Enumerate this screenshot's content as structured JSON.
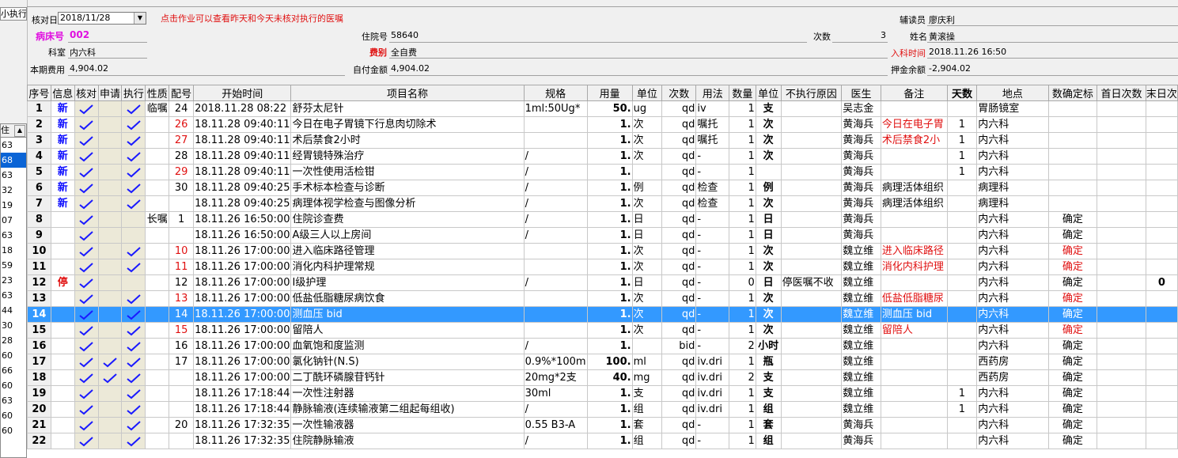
{
  "left": {
    "tab_label": "小执行",
    "list_header": "住",
    "items": [
      "63",
      "68",
      "63",
      "32",
      "19",
      "07",
      "63",
      "18",
      "59",
      "23",
      "63",
      "44",
      "30",
      "28",
      "60",
      "66",
      "60",
      "63",
      "60",
      "60"
    ],
    "selected_index": 1
  },
  "header": {
    "check_date_label": "核对日",
    "check_date_value": "2018/11/28",
    "hint": "点击作业可以查看昨天和今天未核对执行的医嘱",
    "reader_label": "辅读员",
    "reader_value": "廖庆利",
    "bed_label": "病床号",
    "bed_value": "002",
    "admission_label": "住院号",
    "admission_value": "58640",
    "times_label": "次数",
    "times_value": "3",
    "name_label": "姓名",
    "name_value": "黄滚操",
    "dept_label": "科室",
    "dept_value": "内六科",
    "fee_type_label": "费别",
    "fee_type_value": "全自费",
    "admit_time_label": "入科时间",
    "admit_time_value": "2018.11.26 16:50",
    "period_cost_label": "本期费用",
    "period_cost_value": "4,904.02",
    "self_pay_label": "自付金额",
    "self_pay_value": "4,904.02",
    "deposit_label": "押金余额",
    "deposit_value": "-2,904.02"
  },
  "grid": {
    "columns": [
      "序号",
      "信息",
      "核对",
      "申请",
      "执行",
      "性质",
      "配号",
      "开始时间",
      "项目名称",
      "规格",
      "用量",
      "单位",
      "次数",
      "用法",
      "数量",
      "单位",
      "不执行原因",
      "医生",
      "备注",
      "天数",
      "地点",
      "数确定标",
      "首日次数",
      "末日次"
    ],
    "rows": [
      {
        "seq": "1",
        "info": "新",
        "check": true,
        "apply": false,
        "exec": true,
        "nature": "临嘱",
        "group": "24",
        "group_red": false,
        "start": "2018.11.28 08:22",
        "item": "舒芬太尼针",
        "spec": "1ml:50Ug*",
        "dose": "50.",
        "unit": "ug",
        "freq": "qd",
        "usage": "iv",
        "qty": "1",
        "unit2": "支",
        "reason": "",
        "doctor": "吴志金",
        "note": "",
        "note_red": false,
        "days": "",
        "place": "胃肠镜室",
        "confirm": "",
        "confirm_red": false,
        "first": "",
        "last": ""
      },
      {
        "seq": "2",
        "info": "新",
        "check": true,
        "apply": false,
        "exec": true,
        "nature": "",
        "group": "26",
        "group_red": true,
        "start": "18.11.28 09:40:11",
        "item": "今日在电子胃镜下行息肉切除术",
        "spec": "",
        "dose": "1.",
        "unit": "次",
        "freq": "qd",
        "usage": "嘱托",
        "qty": "1",
        "unit2": "次",
        "reason": "",
        "doctor": "黄海兵",
        "note": "今日在电子胃",
        "note_red": true,
        "days": "1",
        "place": "内六科",
        "confirm": "",
        "confirm_red": false,
        "first": "",
        "last": ""
      },
      {
        "seq": "3",
        "info": "新",
        "check": true,
        "apply": false,
        "exec": true,
        "nature": "",
        "group": "27",
        "group_red": true,
        "start": "18.11.28 09:40:11",
        "item": "术后禁食2小时",
        "spec": "",
        "dose": "1.",
        "unit": "次",
        "freq": "qd",
        "usage": "嘱托",
        "qty": "1",
        "unit2": "次",
        "reason": "",
        "doctor": "黄海兵",
        "note": "术后禁食2小",
        "note_red": true,
        "days": "1",
        "place": "内六科",
        "confirm": "",
        "confirm_red": false,
        "first": "",
        "last": ""
      },
      {
        "seq": "4",
        "info": "新",
        "check": true,
        "apply": false,
        "exec": true,
        "nature": "",
        "group": "28",
        "group_red": false,
        "start": "18.11.28 09:40:11",
        "item": "经胃镜特殊治疗",
        "spec": "/",
        "dose": "1.",
        "unit": "次",
        "freq": "qd",
        "usage": "-",
        "qty": "1",
        "unit2": "次",
        "reason": "",
        "doctor": "黄海兵",
        "note": "",
        "note_red": false,
        "days": "1",
        "place": "内六科",
        "confirm": "",
        "confirm_red": false,
        "first": "",
        "last": ""
      },
      {
        "seq": "5",
        "info": "新",
        "check": true,
        "apply": false,
        "exec": true,
        "nature": "",
        "group": "29",
        "group_red": true,
        "start": "18.11.28 09:40:11",
        "item": "一次性使用活检钳",
        "spec": " /",
        "dose": "1.",
        "unit": "",
        "freq": "qd",
        "usage": "-",
        "qty": "1",
        "unit2": "",
        "reason": "",
        "doctor": "黄海兵",
        "note": "",
        "note_red": false,
        "days": "1",
        "place": "内六科",
        "confirm": "",
        "confirm_red": false,
        "first": "",
        "last": ""
      },
      {
        "seq": "6",
        "info": "新",
        "check": true,
        "apply": false,
        "exec": true,
        "nature": "",
        "group": "30",
        "group_red": false,
        "start": "18.11.28 09:40:25",
        "item": "手术标本检查与诊断",
        "spec": "/",
        "dose": "1.",
        "unit": "例",
        "freq": "qd",
        "usage": "检查",
        "qty": "1",
        "unit2": "例",
        "reason": "",
        "doctor": "黄海兵",
        "note": "病理活体组织",
        "note_red": false,
        "days": "",
        "place": "病理科",
        "confirm": "",
        "confirm_red": false,
        "first": "",
        "last": ""
      },
      {
        "seq": "7",
        "info": "新",
        "check": true,
        "apply": false,
        "exec": true,
        "nature": "",
        "group": "",
        "group_red": false,
        "start": "18.11.28 09:40:25",
        "item": "病理体视学检查与图像分析",
        "spec": "/",
        "dose": "1.",
        "unit": "次",
        "freq": "qd",
        "usage": "检查",
        "qty": "1",
        "unit2": "次",
        "reason": "",
        "doctor": "黄海兵",
        "note": "病理活体组织",
        "note_red": false,
        "days": "",
        "place": "病理科",
        "confirm": "",
        "confirm_red": false,
        "first": "",
        "last": ""
      },
      {
        "seq": "8",
        "info": "",
        "check": true,
        "apply": false,
        "exec": false,
        "nature": "长嘱",
        "group": "1",
        "group_red": false,
        "start": "18.11.26 16:50:00",
        "item": "住院诊查费",
        "spec": "/",
        "dose": "1.",
        "unit": "日",
        "freq": "qd",
        "usage": "-",
        "qty": "1",
        "unit2": "日",
        "reason": "",
        "doctor": "黄海兵",
        "note": "",
        "note_red": false,
        "days": "",
        "place": "内六科",
        "confirm": "确定",
        "confirm_red": false,
        "first": "",
        "last": ""
      },
      {
        "seq": "9",
        "info": "",
        "check": true,
        "apply": false,
        "exec": false,
        "nature": "",
        "group": "",
        "group_red": false,
        "start": "18.11.26 16:50:00",
        "item": "A级三人以上房间",
        "spec": "/",
        "dose": "1.",
        "unit": "日",
        "freq": "qd",
        "usage": "-",
        "qty": "1",
        "unit2": "日",
        "reason": "",
        "doctor": "黄海兵",
        "note": "",
        "note_red": false,
        "days": "",
        "place": "内六科",
        "confirm": "确定",
        "confirm_red": false,
        "first": "",
        "last": ""
      },
      {
        "seq": "10",
        "info": "",
        "check": true,
        "apply": false,
        "exec": true,
        "nature": "",
        "group": "10",
        "group_red": true,
        "start": "18.11.26 17:00:00",
        "item": "进入临床路径管理",
        "spec": "",
        "dose": "1.",
        "unit": "次",
        "freq": "qd",
        "usage": "-",
        "qty": "1",
        "unit2": "次",
        "reason": "",
        "doctor": "魏立维",
        "note": "进入临床路径",
        "note_red": true,
        "days": "",
        "place": "内六科",
        "confirm": "确定",
        "confirm_red": true,
        "first": "",
        "last": ""
      },
      {
        "seq": "11",
        "info": "",
        "check": true,
        "apply": false,
        "exec": true,
        "nature": "",
        "group": "11",
        "group_red": true,
        "start": "18.11.26 17:00:00",
        "item": "消化内科护理常规",
        "spec": "",
        "dose": "1.",
        "unit": "次",
        "freq": "qd",
        "usage": "-",
        "qty": "1",
        "unit2": "次",
        "reason": "",
        "doctor": "魏立维",
        "note": "消化内科护理",
        "note_red": true,
        "days": "",
        "place": "内六科",
        "confirm": "确定",
        "confirm_red": true,
        "first": "",
        "last": ""
      },
      {
        "seq": "12",
        "info": "停",
        "check": true,
        "apply": false,
        "exec": false,
        "nature": "",
        "group": "12",
        "group_red": false,
        "start": "18.11.26 17:00:00",
        "item": "Ⅰ级护理",
        "spec": "/",
        "dose": "1.",
        "unit": "日",
        "freq": "qd",
        "usage": "-",
        "qty": "0",
        "unit2": "日",
        "reason": "停医嘱不收",
        "doctor": "魏立维",
        "note": "",
        "note_red": false,
        "days": "",
        "place": "内六科",
        "confirm": "确定",
        "confirm_red": false,
        "first": "",
        "last": "0"
      },
      {
        "seq": "13",
        "info": "",
        "check": true,
        "apply": false,
        "exec": true,
        "nature": "",
        "group": "13",
        "group_red": true,
        "start": "18.11.26 17:00:00",
        "item": "低盐低脂糖尿病饮食",
        "spec": "",
        "dose": "1.",
        "unit": "次",
        "freq": "qd",
        "usage": "-",
        "qty": "1",
        "unit2": "次",
        "reason": "",
        "doctor": "魏立维",
        "note": "低盐低脂糖尿",
        "note_red": true,
        "days": "",
        "place": "内六科",
        "confirm": "确定",
        "confirm_red": true,
        "first": "",
        "last": ""
      },
      {
        "seq": "14",
        "info": "",
        "check": true,
        "apply": false,
        "exec": true,
        "nature": "",
        "group": "14",
        "group_red": false,
        "start": "18.11.26 17:00:00",
        "item": "测血压 bid",
        "spec": "",
        "dose": "1.",
        "unit": "次",
        "freq": "qd",
        "usage": "-",
        "qty": "1",
        "unit2": "次",
        "reason": "",
        "doctor": "魏立维",
        "note": "测血压 bid",
        "note_red": false,
        "days": "",
        "place": "内六科",
        "confirm": "确定",
        "confirm_red": false,
        "first": "",
        "last": "",
        "selected": true
      },
      {
        "seq": "15",
        "info": "",
        "check": true,
        "apply": false,
        "exec": true,
        "nature": "",
        "group": "15",
        "group_red": true,
        "start": "18.11.26 17:00:00",
        "item": "留陪人",
        "spec": "",
        "dose": "1.",
        "unit": "次",
        "freq": "qd",
        "usage": "-",
        "qty": "1",
        "unit2": "次",
        "reason": "",
        "doctor": "魏立维",
        "note": "留陪人",
        "note_red": true,
        "days": "",
        "place": "内六科",
        "confirm": "确定",
        "confirm_red": true,
        "first": "",
        "last": ""
      },
      {
        "seq": "16",
        "info": "",
        "check": true,
        "apply": false,
        "exec": true,
        "nature": "",
        "group": "16",
        "group_red": false,
        "start": "18.11.26 17:00:00",
        "item": "血氧饱和度监测",
        "spec": "/",
        "dose": "1.",
        "unit": "",
        "freq": "bid",
        "usage": "-",
        "qty": "2",
        "unit2": "小时",
        "reason": "",
        "doctor": "魏立维",
        "note": "",
        "note_red": false,
        "days": "",
        "place": "内六科",
        "confirm": "确定",
        "confirm_red": false,
        "first": "",
        "last": ""
      },
      {
        "seq": "17",
        "info": "",
        "check": true,
        "apply": true,
        "exec": true,
        "nature": "",
        "group": "17",
        "group_red": false,
        "start": "18.11.26 17:00:00",
        "item": "氯化钠针(N.S)",
        "spec": "0.9%*100m",
        "dose": "100.",
        "unit": "ml",
        "freq": "qd",
        "usage": "iv.dri",
        "qty": "1",
        "unit2": "瓶",
        "reason": "",
        "doctor": "魏立维",
        "note": "",
        "note_red": false,
        "days": "",
        "place": "西药房",
        "confirm": "确定",
        "confirm_red": false,
        "first": "",
        "last": ""
      },
      {
        "seq": "18",
        "info": "",
        "check": true,
        "apply": true,
        "exec": true,
        "nature": "",
        "group": "",
        "group_red": false,
        "start": "18.11.26 17:00:00",
        "item": "二丁酰环磷腺苷钙针",
        "spec": "20mg*2支",
        "dose": "40.",
        "unit": "mg",
        "freq": "qd",
        "usage": "iv.dri",
        "qty": "2",
        "unit2": "支",
        "reason": "",
        "doctor": "魏立维",
        "note": "",
        "note_red": false,
        "days": "",
        "place": "西药房",
        "confirm": "确定",
        "confirm_red": false,
        "first": "",
        "last": ""
      },
      {
        "seq": "19",
        "info": "",
        "check": true,
        "apply": false,
        "exec": true,
        "nature": "",
        "group": "",
        "group_red": false,
        "start": "18.11.26 17:18:44",
        "item": "一次性注射器",
        "spec": "30ml",
        "dose": "1.",
        "unit": "支",
        "freq": "qd",
        "usage": "iv.dri",
        "qty": "1",
        "unit2": "支",
        "reason": "",
        "doctor": "魏立维",
        "note": "",
        "note_red": false,
        "days": "1",
        "place": "内六科",
        "confirm": "确定",
        "confirm_red": false,
        "first": "",
        "last": ""
      },
      {
        "seq": "20",
        "info": "",
        "check": true,
        "apply": false,
        "exec": true,
        "nature": "",
        "group": "",
        "group_red": false,
        "start": "18.11.26 17:18:44",
        "item": "静脉输液(连续输液第二组起每组收)",
        "spec": "/",
        "dose": "1.",
        "unit": "组",
        "freq": "qd",
        "usage": "iv.dri",
        "qty": "1",
        "unit2": "组",
        "reason": "",
        "doctor": "魏立维",
        "note": "",
        "note_red": false,
        "days": "1",
        "place": "内六科",
        "confirm": "确定",
        "confirm_red": false,
        "first": "",
        "last": ""
      },
      {
        "seq": "21",
        "info": "",
        "check": true,
        "apply": false,
        "exec": true,
        "nature": "",
        "group": "20",
        "group_red": false,
        "start": "18.11.26 17:32:35",
        "item": "一次性输液器",
        "spec": "0.55 B3-A",
        "dose": "1.",
        "unit": "套",
        "freq": "qd",
        "usage": "-",
        "qty": "1",
        "unit2": "套",
        "reason": "",
        "doctor": "黄海兵",
        "note": "",
        "note_red": false,
        "days": "",
        "place": "内六科",
        "confirm": "确定",
        "confirm_red": false,
        "first": "",
        "last": ""
      },
      {
        "seq": "22",
        "info": "",
        "check": true,
        "apply": false,
        "exec": true,
        "nature": "",
        "group": "",
        "group_red": false,
        "start": "18.11.26 17:32:35",
        "item": "住院静脉输液",
        "spec": "/",
        "dose": "1.",
        "unit": "组",
        "freq": "qd",
        "usage": "-",
        "qty": "1",
        "unit2": "组",
        "reason": "",
        "doctor": "黄海兵",
        "note": "",
        "note_red": false,
        "days": "",
        "place": "内六科",
        "confirm": "确定",
        "confirm_red": false,
        "first": "",
        "last": ""
      }
    ]
  },
  "colors": {
    "accent_blue": "#1010ff",
    "red": "#e01010",
    "magenta": "#e010e0",
    "selection": "#3399ff"
  }
}
